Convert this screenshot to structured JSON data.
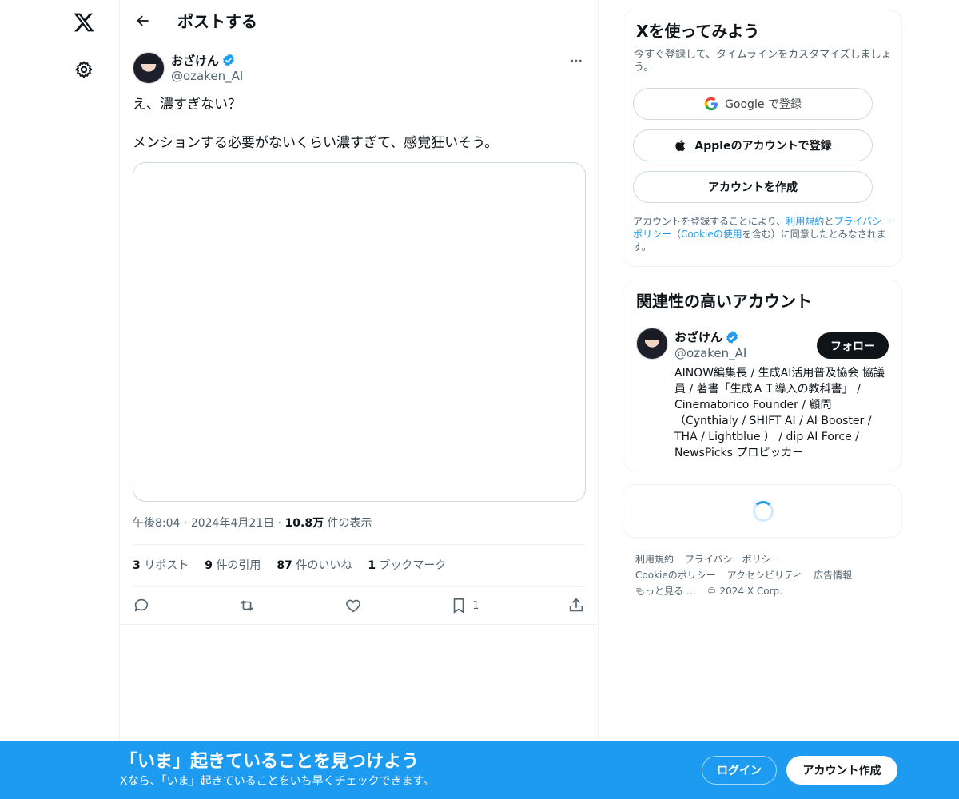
{
  "nav": {
    "logo_icon": "x-logo-icon",
    "settings_icon": "gear-icon"
  },
  "header": {
    "title": "ポストする",
    "back_icon": "arrow-left-icon"
  },
  "post": {
    "author_name": "おざけん",
    "author_handle": "@ozaken_AI",
    "text": "え、濃すぎない？\n\nメンションする必要がないくらい濃すぎて、感覚狂いそう。",
    "time": "午後8:04",
    "date": "2024年4月21日",
    "views_count": "10.8万",
    "views_label": "件の表示",
    "separator": "·",
    "stats": {
      "reposts_num": "3",
      "reposts_label": "リポスト",
      "quotes_num": "9",
      "quotes_label": "件の引用",
      "likes_num": "87",
      "likes_label": "件のいいね",
      "bookmarks_num": "1",
      "bookmarks_label": "ブックマーク"
    },
    "bookmark_action_count": "1"
  },
  "signup": {
    "title": "Xを使ってみよう",
    "subtitle": "今すぐ登録して、タイムラインをカスタマイズしましょう。",
    "google_label": "Google で登録",
    "apple_label": "Appleのアカウントで登録",
    "create_label": "アカウントを作成",
    "legal_prefix": "アカウントを登録することにより、",
    "legal_terms": "利用規約",
    "legal_and": "と",
    "legal_privacy": "プライバシーポリシー",
    "legal_open": "（",
    "legal_cookie": "Cookieの使用",
    "legal_suffix": "を含む）に同意したとみなされます。"
  },
  "related": {
    "title": "関連性の高いアカウント",
    "name": "おざけん",
    "handle": "@ozaken_AI",
    "follow_label": "フォロー",
    "bio": "AINOW編集長 / 生成AI活用普及協会 協議員 / 著書「生成ＡＩ導入の教科書」 / Cinematorico Founder / 顧問（Cynthialy / SHIFT AI / AI Booster / THA / Lightblue ） / dip AI Force / NewsPicks プロピッカー"
  },
  "footer": {
    "terms": "利用規約",
    "privacy": "プライバシーポリシー",
    "cookie": "Cookieのポリシー",
    "accessibility": "アクセシビリティ",
    "ads": "広告情報",
    "more": "もっと見る …",
    "copyright": "© 2024 X Corp."
  },
  "banner": {
    "title": "「いま」起きていることを見つけよう",
    "subtitle": "Xなら、「いま」起きていることをいち早くチェックできます。",
    "login_label": "ログイン",
    "signup_label": "アカウント作成"
  },
  "colors": {
    "accent": "#1d9bf0",
    "text": "#0f1419",
    "muted": "#536471"
  }
}
